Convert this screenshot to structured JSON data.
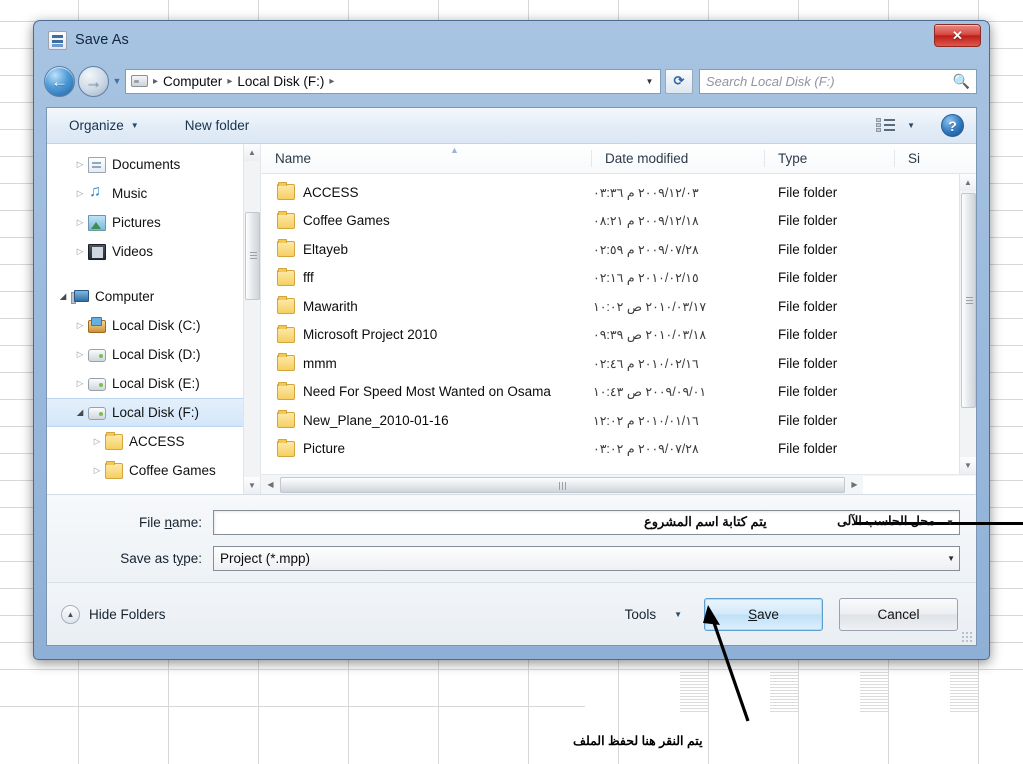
{
  "window": {
    "title": "Save As",
    "app_icon": "project-document-icon",
    "close_label": "✕"
  },
  "navbar": {
    "back_icon": "back-arrow-icon",
    "forward_icon": "forward-arrow-icon",
    "history_icon": "chevron-down-icon",
    "drive_icon": "drive-icon",
    "breadcrumbs": [
      "Computer",
      "Local Disk (F:)"
    ],
    "separator": "▸",
    "address_caret": "▼",
    "refresh_icon": "refresh-icon",
    "search_placeholder": "Search Local Disk (F:)",
    "search_icon": "search-icon"
  },
  "commandbar": {
    "organize_label": "Organize",
    "organize_caret": "▼",
    "newfolder_label": "New folder",
    "view_icon": "view-list-icon",
    "view_caret": "▼",
    "help_icon": "help-icon",
    "help_glyph": "?"
  },
  "nav_pane": {
    "items": [
      {
        "label": "Documents",
        "icon": "document-icon",
        "indent": 1,
        "twisty": "▷",
        "expanded": false,
        "selected": false
      },
      {
        "label": "Music",
        "icon": "music-icon",
        "indent": 1,
        "twisty": "▷",
        "expanded": false,
        "selected": false
      },
      {
        "label": "Pictures",
        "icon": "picture-icon",
        "indent": 1,
        "twisty": "▷",
        "expanded": false,
        "selected": false
      },
      {
        "label": "Videos",
        "icon": "video-icon",
        "indent": 1,
        "twisty": "▷",
        "expanded": false,
        "selected": false
      },
      {
        "label": "",
        "icon": "spacer",
        "indent": 0,
        "twisty": "",
        "expanded": false,
        "selected": false
      },
      {
        "label": "Computer",
        "icon": "computer-icon",
        "indent": 0,
        "twisty": "◢",
        "expanded": true,
        "selected": false
      },
      {
        "label": "Local Disk (C:)",
        "icon": "system-drive-icon",
        "indent": 1,
        "twisty": "▷",
        "expanded": false,
        "selected": false
      },
      {
        "label": "Local Disk (D:)",
        "icon": "drive-icon",
        "indent": 1,
        "twisty": "▷",
        "expanded": false,
        "selected": false
      },
      {
        "label": "Local Disk (E:)",
        "icon": "drive-icon",
        "indent": 1,
        "twisty": "▷",
        "expanded": false,
        "selected": false
      },
      {
        "label": "Local Disk (F:)",
        "icon": "drive-icon",
        "indent": 1,
        "twisty": "◢",
        "expanded": true,
        "selected": true
      },
      {
        "label": "ACCESS",
        "icon": "folder-icon",
        "indent": 2,
        "twisty": "▷",
        "expanded": false,
        "selected": false
      },
      {
        "label": "Coffee Games",
        "icon": "folder-icon",
        "indent": 2,
        "twisty": "▷",
        "expanded": false,
        "selected": false
      }
    ],
    "scroll_up": "▲",
    "scroll_down": "▼"
  },
  "list": {
    "columns": [
      "Name",
      "Date modified",
      "Type",
      "Si"
    ],
    "sort_indicator": "▲",
    "rows": [
      {
        "name": "ACCESS",
        "date": "٢٠٠٩/١٢/٠٣ م ٠٣:٣٦",
        "type": "File folder",
        "size": ""
      },
      {
        "name": "Coffee Games",
        "date": "٢٠٠٩/١٢/١٨ م ٠٨:٢١",
        "type": "File folder",
        "size": ""
      },
      {
        "name": "Eltayeb",
        "date": "٢٠٠٩/٠٧/٢٨ م ٠٢:٥٩",
        "type": "File folder",
        "size": ""
      },
      {
        "name": "fff",
        "date": "٢٠١٠/٠٢/١٥ م ٠٢:١٦",
        "type": "File folder",
        "size": ""
      },
      {
        "name": "Mawarith",
        "date": "٢٠١٠/٠٣/١٧ ص ١٠:٠٢",
        "type": "File folder",
        "size": ""
      },
      {
        "name": "Microsoft Project 2010",
        "date": "٢٠١٠/٠٣/١٨ ص ٠٩:٣٩",
        "type": "File folder",
        "size": ""
      },
      {
        "name": "mmm",
        "date": "٢٠١٠/٠٢/١٦ م ٠٢:٤٦",
        "type": "File folder",
        "size": ""
      },
      {
        "name": "Need For Speed Most Wanted on Osama",
        "date": "٢٠٠٩/٠٩/٠١ ص ١٠:٤٣",
        "type": "File folder",
        "size": ""
      },
      {
        "name": "New_Plane_2010-01-16",
        "date": "٢٠١٠/٠١/١٦ م ١٢:٠٢",
        "type": "File folder",
        "size": ""
      },
      {
        "name": "Picture",
        "date": "٢٠٠٩/٠٧/٢٨ م ٠٣:٠٢",
        "type": "File folder",
        "size": ""
      }
    ],
    "hscroll_left": "◀",
    "hscroll_right": "▶",
    "vscroll_up": "▲",
    "vscroll_down": "▼"
  },
  "form": {
    "filename_label_pre": "File ",
    "filename_label_accel": "n",
    "filename_label_post": "ame:",
    "filename_value": "محل الحاسب الآلى",
    "filename_annotation": "يتم كتابة اسم المشروع",
    "filename_caret": "▼",
    "savetype_label_pre": "Save as t",
    "savetype_label_accel": "y",
    "savetype_label_post": "pe:",
    "savetype_value": "Project (*.mpp)",
    "savetype_caret": "▼"
  },
  "footer": {
    "hide_folders_label": "Hide Folders",
    "hide_folders_icon": "collapse-icon",
    "hide_folders_glyph": "▲",
    "tools_label": "Tools",
    "tools_caret": "▼",
    "save_label_pre": "",
    "save_label_accel": "S",
    "save_label_post": "ave",
    "cancel_label": "Cancel"
  },
  "annotation": {
    "pointer_caption": "يتم النقر هنا لحفظ الملف"
  },
  "colors": {
    "dialog_frame": "#8fb0d6",
    "accent_blue": "#2f79c0",
    "close_red": "#bb1f18",
    "selection_blue": "#d3e6f9",
    "folder_yellow": "#f6cf63"
  }
}
